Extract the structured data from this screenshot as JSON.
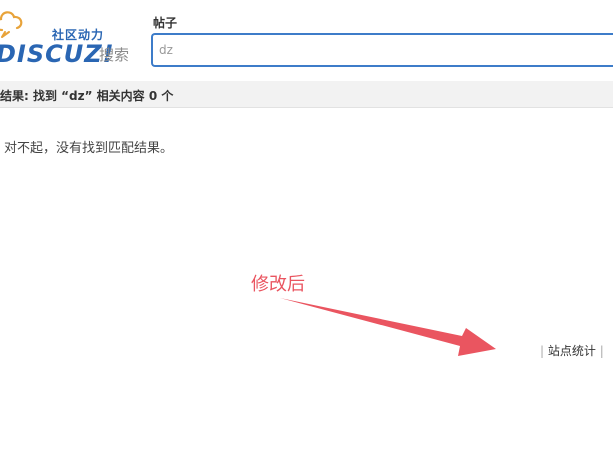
{
  "header": {
    "logo_tagline": "社区动力",
    "logo_wordmark": "DISCUZ!",
    "search_label": "搜索",
    "logo_icon": "cloud-logo-icon"
  },
  "search": {
    "active_tab": "帖子",
    "query_value": "dz",
    "border_color": "#3d7cc9"
  },
  "results": {
    "summary": "结果: 找到 “dz” 相关内容 0 个",
    "empty_message": "对不起，没有找到匹配结果。"
  },
  "annotation": {
    "note": "修改后",
    "color": "#ea5560",
    "icon": "arrow-annotation-icon"
  },
  "footer": {
    "separator_left": "|",
    "stats_link": "站点统计",
    "separator_right": "|"
  }
}
